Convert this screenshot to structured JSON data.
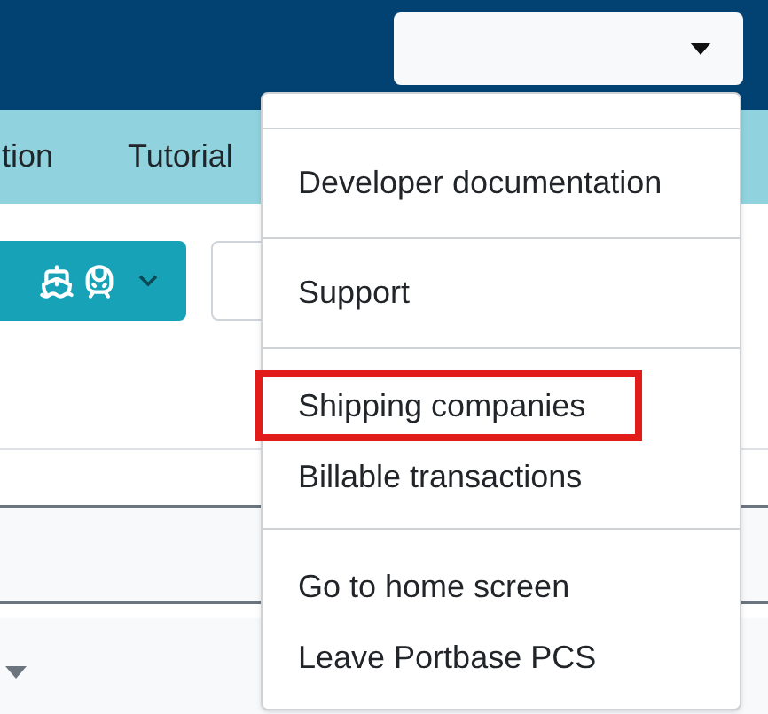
{
  "nav": {
    "items": [
      {
        "label": "tion"
      },
      {
        "label": "Tutorial"
      }
    ]
  },
  "user_menu": {
    "sections": [
      {
        "items": [
          {
            "label": "Developer documentation",
            "highlighted": false
          }
        ]
      },
      {
        "items": [
          {
            "label": "Support",
            "highlighted": false
          }
        ]
      },
      {
        "items": [
          {
            "label": "Shipping companies",
            "highlighted": true
          },
          {
            "label": "Billable transactions",
            "highlighted": false
          }
        ]
      },
      {
        "items": [
          {
            "label": "Go to home screen",
            "highlighted": false
          },
          {
            "label": "Leave Portbase PCS",
            "highlighted": false
          }
        ]
      }
    ]
  }
}
